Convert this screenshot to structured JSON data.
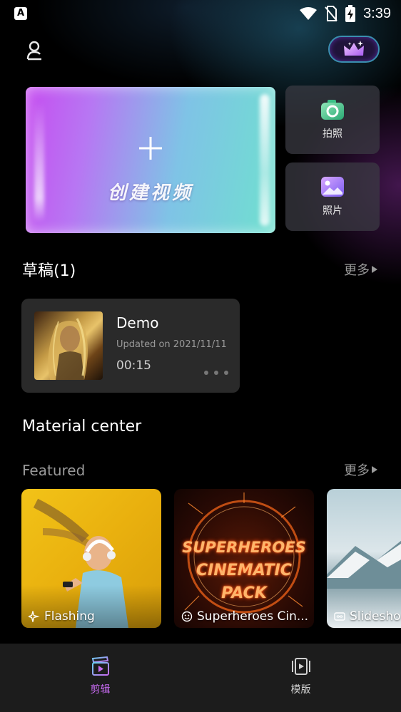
{
  "status_bar": {
    "time": "3:39",
    "app_icon_glyph": "A"
  },
  "create": {
    "label": "创建视频"
  },
  "side_tiles": [
    {
      "label": "拍照",
      "icon": "camera-icon"
    },
    {
      "label": "照片",
      "icon": "gallery-icon"
    }
  ],
  "drafts": {
    "title": "草稿(1)",
    "more": "更多",
    "items": [
      {
        "title": "Demo",
        "updated": "Updated on 2021/11/11",
        "duration": "00:15"
      }
    ]
  },
  "material_center": {
    "title": "Material center"
  },
  "featured": {
    "title": "Featured",
    "more": "更多",
    "cards": [
      {
        "caption": "Flashing",
        "icon": "sparkle-icon"
      },
      {
        "caption": "Superheroes Cin...",
        "icon": "smiley-icon",
        "promo_lines": [
          "SUPERHEROES",
          "CINEMATIC",
          "PACK"
        ]
      },
      {
        "caption": "Slidesho",
        "icon": "loop-icon"
      }
    ]
  },
  "bottom_nav": [
    {
      "label": "剪辑",
      "active": true,
      "icon": "clapperboard-icon"
    },
    {
      "label": "模版",
      "active": false,
      "icon": "template-icon"
    }
  ],
  "colors": {
    "accent_purple": "#c86bf2",
    "inactive": "#cfcfcf",
    "muted_text": "#9a9a9a",
    "card_bg": "#2a2a2a",
    "nav_bg": "#1c1c1c"
  }
}
